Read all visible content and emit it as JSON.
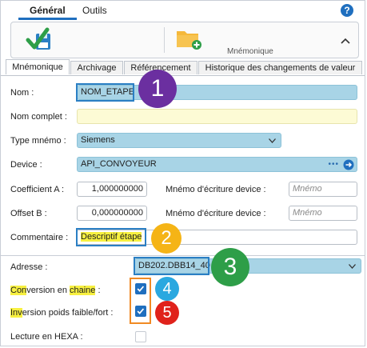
{
  "top_tabs": {
    "general": "Général",
    "outils": "Outils"
  },
  "ribbon": {
    "mnemonique_label": "Mnémonique"
  },
  "sub_tabs": [
    "Mnémonique",
    "Archivage",
    "Référencement",
    "Historique des changements de valeur"
  ],
  "form": {
    "nom": {
      "label": "Nom :",
      "value": "NOM_ETAPE"
    },
    "nom_complet": {
      "label": "Nom complet :",
      "value": ""
    },
    "type_mnemo": {
      "label": "Type mnémo :",
      "value": "Siemens"
    },
    "device": {
      "label": "Device :",
      "value": "API_CONVOYEUR",
      "more": "•••"
    },
    "coefficient_a": {
      "label": "Coefficient A :",
      "value": "1,000000000",
      "write_label": "Mnémo d'écriture device :",
      "write_placeholder": "Mnémo"
    },
    "offset_b": {
      "label": "Offset B :",
      "value": "0,000000000",
      "write_label": "Mnémo d'écriture device :",
      "write_placeholder": "Mnémo"
    },
    "commentaire": {
      "label": "Commentaire :",
      "value": "Descriptif étape"
    },
    "adresse": {
      "label": "Adresse :",
      "value": "DB202.DBB14_40"
    },
    "conversion": {
      "label_hl": "Con",
      "label_mid": "version en ",
      "label_hl2": "chaine",
      "label_end": " :",
      "checked": true
    },
    "inversion": {
      "label_hl": "Inv",
      "label_end": "ersion poids faible/fort :",
      "checked": true
    },
    "lecture_hexa": {
      "label": "Lecture en HEXA :",
      "checked": false
    }
  },
  "annotations": {
    "badge1": "1",
    "badge2": "2",
    "badge3": "3",
    "badge4": "4",
    "badge5": "5"
  },
  "colors": {
    "accent_blue": "#1f6fbf",
    "field_blue": "#a8d4e6",
    "field_yellow": "#fdfbd5",
    "badge1": "#6b2fa0",
    "badge2": "#f5b416",
    "badge3": "#2e9e48",
    "badge4": "#2aa8e0",
    "badge5": "#e0221b",
    "annotation_box": "#f08a24"
  }
}
